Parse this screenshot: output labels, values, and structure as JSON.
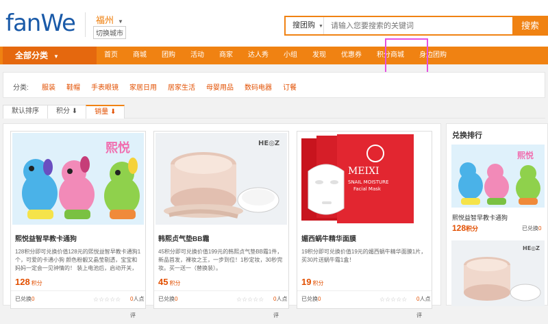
{
  "header": {
    "logo": "fanWe",
    "city": "福州",
    "switch_city": "切换城市",
    "search_type": "搜团购",
    "search_placeholder": "请输入您要搜索的关键词",
    "search_button": "搜索"
  },
  "nav": {
    "all_label": "全部分类",
    "items": [
      "首页",
      "商城",
      "团购",
      "活动",
      "商家",
      "达人秀",
      "小组",
      "发现",
      "优惠券",
      "积分商城",
      "身边团购"
    ],
    "highlighted": "积分商城"
  },
  "categories": {
    "label": "分类:",
    "items": [
      "服装",
      "鞋帽",
      "手表眼镜",
      "家居日用",
      "居家生活",
      "母婴用品",
      "数码电器",
      "订餐"
    ]
  },
  "sort": {
    "items": [
      "默认排序",
      "积分 ⬇",
      "销量 ⬇"
    ],
    "active_index": 2
  },
  "products": [
    {
      "name": "熙悦益智早教卡通狗",
      "desc": "128积分即可兑换价值128元的熙悦益智早教卡通狗1个，可爱的卡通小狗 颜色粉靓又晶莹剔透，宝宝和妈妈一定会一见钟情的！ 装上电池后，启动开关，",
      "points": "128",
      "points_unit": "积分",
      "exchanged_label": "已兑换",
      "exchanged": "0",
      "stars": "☆☆☆☆☆",
      "reviews": "0",
      "reviews_label": "人点评"
    },
    {
      "name": "韩熙贞气垫BB霜",
      "desc": "45积分即可兑换价值199元的韩熙贞气垫BB霜1件，新品首发，裸妆之王，一步到位！1秒定妆，30秒完妆。买一送一（替换装）。",
      "points": "45",
      "points_unit": "积分",
      "exchanged_label": "已兑换",
      "exchanged": "0",
      "stars": "☆☆☆☆☆",
      "reviews": "0",
      "reviews_label": "人点评"
    },
    {
      "name": "媚西蜗牛精华面膜",
      "desc": "19积分即可兑换价值19元的媚西蜗牛精华面膜1片，买30片送蜗牛霜1盒！",
      "points": "19",
      "points_unit": "积分",
      "exchanged_label": "已兑换",
      "exchanged": "0",
      "stars": "☆☆☆☆☆",
      "reviews": "0",
      "reviews_label": "人点评"
    }
  ],
  "sidebar": {
    "title": "兑换排行",
    "item": {
      "name": "熙悦益智早教卡通狗",
      "points": "128",
      "points_unit": "积分",
      "exchanged_label": "已兑换",
      "exchanged": "0"
    }
  },
  "colors": {
    "accent": "#f08212",
    "price": "#e24f00",
    "logo": "#1a5aa8",
    "highlight_box": "#e44fe0"
  }
}
